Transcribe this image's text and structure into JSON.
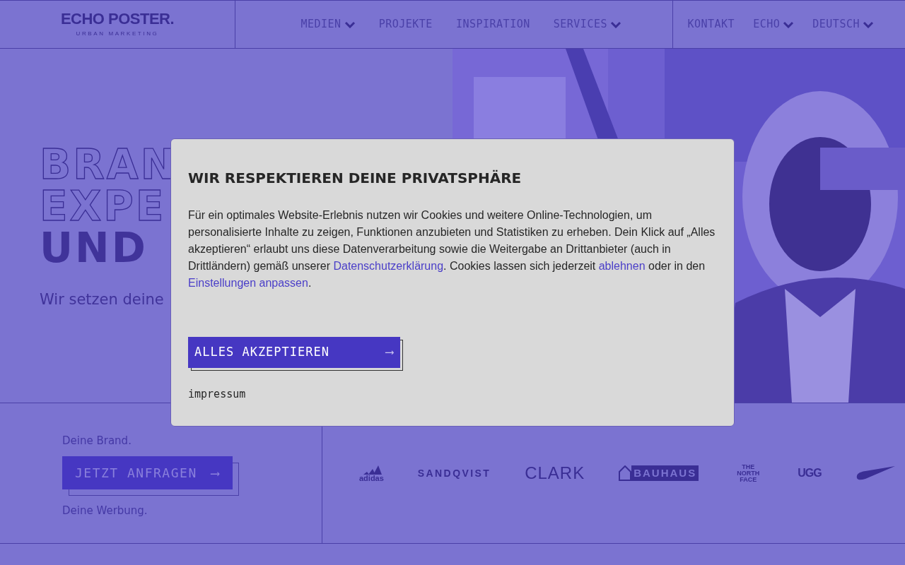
{
  "logo": {
    "title": "ECHO POSTER.",
    "tagline": "URBAN MARKETING"
  },
  "nav": [
    {
      "label": "MEDIEN",
      "dropdown": true
    },
    {
      "label": "PROJEKTE",
      "dropdown": false
    },
    {
      "label": "INSPIRATION",
      "dropdown": false
    },
    {
      "label": "SERVICES",
      "dropdown": true
    }
  ],
  "nav_right": [
    {
      "label": "KONTAKT",
      "dropdown": false
    },
    {
      "label": "ECHO",
      "dropdown": true
    },
    {
      "label": "DEUTSCH",
      "dropdown": true
    }
  ],
  "hero": {
    "lines": [
      {
        "text": "BRAN",
        "kind": "outline"
      },
      {
        "text": "EXPE",
        "kind": "outline"
      },
      {
        "text": "UND",
        "kind": "solid"
      }
    ],
    "subtitle": "Wir setzen deine"
  },
  "cta": {
    "above": "Deine Brand.",
    "button": "JETZT ANFRAGEN",
    "arrow": "⟶",
    "below": "Deine Werbung."
  },
  "brands": [
    {
      "text": "adidas",
      "kind": "stripes"
    },
    {
      "text": "SANDQVIST",
      "kind": "wide"
    },
    {
      "text": "CLARK",
      "kind": "thin"
    },
    {
      "text": "BAUHAUS",
      "kind": "house"
    },
    {
      "text": "THE NORTH FACE",
      "kind": "stacked"
    },
    {
      "text": "UGG",
      "kind": "plain"
    },
    {
      "kind": "swoosh"
    }
  ],
  "cookie_dialog": {
    "title": "WIR RESPEKTIEREN DEINE PRIVATSPHÄRE",
    "body": [
      {
        "text": "Für ein optimales Website-Erlebnis nutzen wir Cookies und weitere Online-Technologien, um personalisierte Inhalte zu zeigen, Funktionen anzubieten und Statistiken zu erheben. Dein Klick auf „Alles akzeptieren“ erlaubt uns diese Datenverarbeitung sowie die Weitergabe an Drittanbieter (auch in Drittländern) gemäß unserer ",
        "kind": "text"
      },
      {
        "text": "Datenschutzerklärung",
        "kind": "link"
      },
      {
        "text": ". Cookies lassen sich jederzeit ",
        "kind": "text"
      },
      {
        "text": "ablehnen",
        "kind": "link"
      },
      {
        "text": " oder in den ",
        "kind": "text"
      },
      {
        "text": "Einstellungen anpassen",
        "kind": "link"
      },
      {
        "text": ".",
        "kind": "text"
      }
    ],
    "button": "ALLES AKZEPTIEREN",
    "arrow": "⟶",
    "footer_link": "impressum"
  }
}
